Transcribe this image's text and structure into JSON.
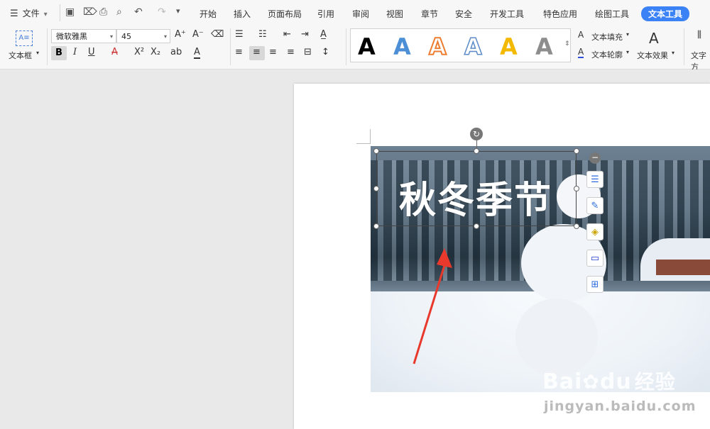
{
  "menubar": {
    "file_label": "文件",
    "tabs": [
      "开始",
      "插入",
      "页面布局",
      "引用",
      "审阅",
      "视图",
      "章节",
      "安全",
      "开发工具",
      "特色应用",
      "绘图工具",
      "文本工具"
    ],
    "active_tab": "文本工具"
  },
  "ribbon": {
    "textbox_label": "文本框",
    "font_name": "微软雅黑",
    "font_size": "45",
    "gallery_glyph": "A",
    "text_fill_label": "文本填充",
    "text_outline_label": "文本轮廓",
    "text_effect_label": "文本效果",
    "text_direction_label": "文字方"
  },
  "document": {
    "title_text": "秋冬季节"
  },
  "watermark": {
    "brand": "Bai",
    "brand2": "du",
    "brand_cn": "经验",
    "url": "jingyan.baidu.com"
  },
  "colors": {
    "accent": "#3b82f6",
    "arrow": "#e8392c"
  }
}
